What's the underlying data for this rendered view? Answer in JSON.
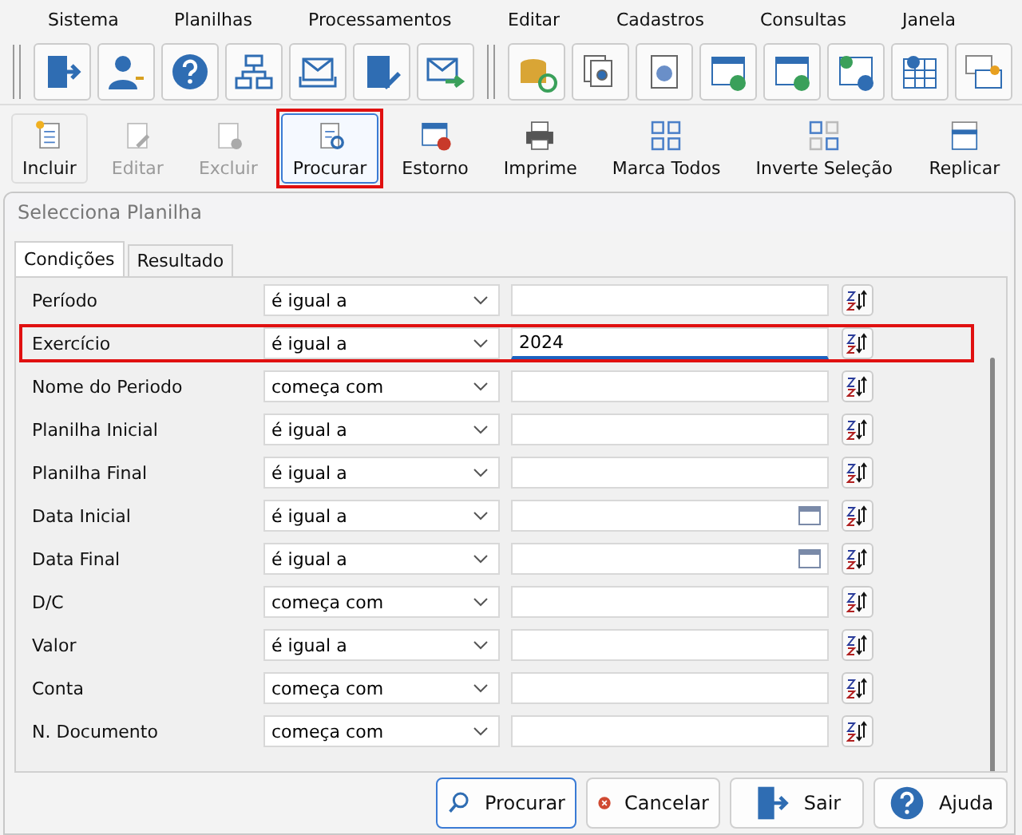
{
  "menu": [
    "Sistema",
    "Planilhas",
    "Processamentos",
    "Editar",
    "Cadastros",
    "Consultas",
    "Janela"
  ],
  "actions": [
    {
      "label": "Incluir",
      "disabled": false,
      "selected": false,
      "highlighted": false
    },
    {
      "label": "Editar",
      "disabled": true,
      "selected": false,
      "highlighted": false
    },
    {
      "label": "Excluir",
      "disabled": true,
      "selected": false,
      "highlighted": false
    },
    {
      "label": "Procurar",
      "disabled": false,
      "selected": true,
      "highlighted": true
    },
    {
      "label": "Estorno",
      "disabled": false,
      "selected": false,
      "highlighted": false
    },
    {
      "label": "Imprime",
      "disabled": false,
      "selected": false,
      "highlighted": false
    },
    {
      "label": "Marca Todos",
      "disabled": false,
      "selected": false,
      "highlighted": false
    },
    {
      "label": "Inverte Seleção",
      "disabled": false,
      "selected": false,
      "highlighted": false
    },
    {
      "label": "Replicar",
      "disabled": false,
      "selected": false,
      "highlighted": false
    }
  ],
  "dialog": {
    "title": "Selecciona Planilha"
  },
  "tabs": [
    {
      "label": "Condições",
      "selected": true
    },
    {
      "label": "Resultado",
      "selected": false
    }
  ],
  "conditions": [
    {
      "field": "Período",
      "operator": "é igual a",
      "kind": "text",
      "highlighted": false
    },
    {
      "field": "Exercício",
      "operator": "é igual a",
      "value": "2024",
      "kind": "text",
      "highlighted": true
    },
    {
      "field": "Nome do Periodo",
      "operator": "começa com",
      "kind": "text",
      "highlighted": false
    },
    {
      "field": "Planilha Inicial",
      "operator": "é igual a",
      "kind": "text",
      "highlighted": false
    },
    {
      "field": "Planilha Final",
      "operator": "é igual a",
      "kind": "text",
      "highlighted": false
    },
    {
      "field": "Data Inicial",
      "operator": "é igual a",
      "kind": "date",
      "highlighted": false
    },
    {
      "field": "Data Final",
      "operator": "é igual a",
      "kind": "date",
      "highlighted": false
    },
    {
      "field": "D/C",
      "operator": "começa com",
      "kind": "text",
      "highlighted": false
    },
    {
      "field": "Valor",
      "operator": "é igual a",
      "kind": "text",
      "highlighted": false
    },
    {
      "field": "Conta",
      "operator": "começa com",
      "kind": "text",
      "highlighted": false
    },
    {
      "field": "N. Documento",
      "operator": "começa com",
      "kind": "text",
      "highlighted": false
    }
  ],
  "buttons": [
    {
      "label": "Procurar",
      "kind": "search",
      "selected": true
    },
    {
      "label": "Cancelar",
      "kind": "cancel",
      "selected": false
    },
    {
      "label": "Sair",
      "kind": "exit",
      "selected": false
    },
    {
      "label": "Ajuda",
      "kind": "help",
      "selected": false
    }
  ]
}
